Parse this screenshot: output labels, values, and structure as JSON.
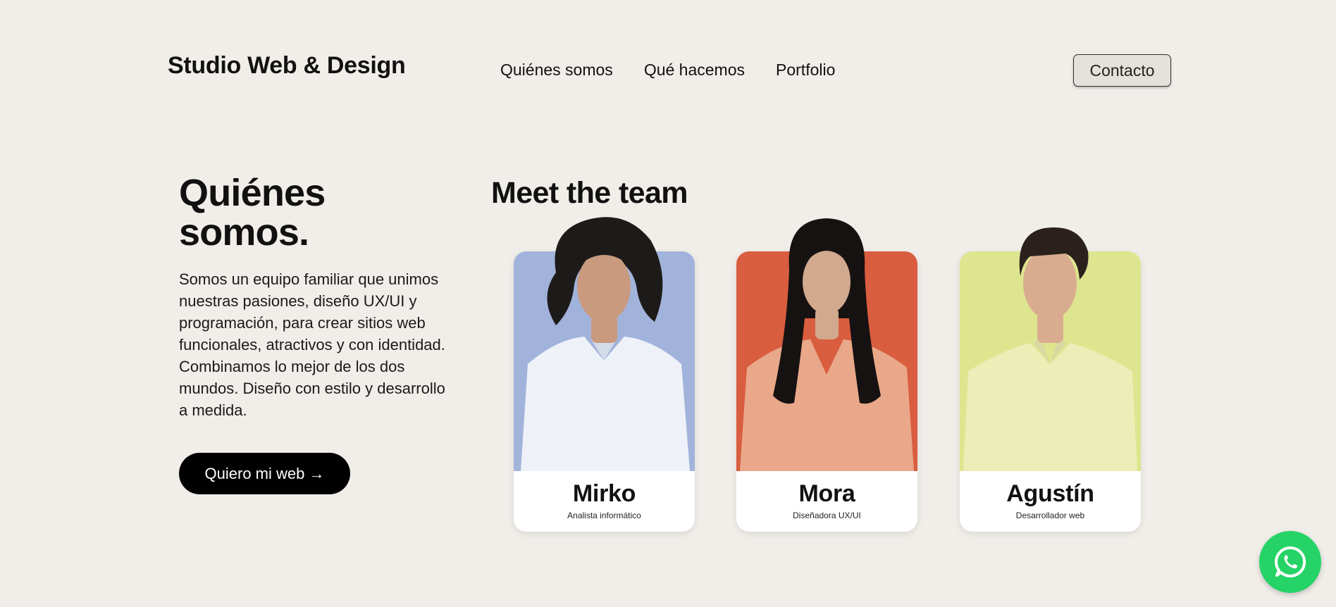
{
  "header": {
    "brand": "Studio Web & Design",
    "nav": [
      "Quiénes somos",
      "Qué hacemos",
      "Portfolio"
    ],
    "contact_label": "Contacto"
  },
  "about": {
    "heading": "Quiénes somos.",
    "paragraph_1": "Somos un equipo familiar que unimos nuestras pasiones, diseño UX/UI y programación, para crear sitios web funcionales, atractivos y con identidad.",
    "paragraph_2": "Combinamos lo mejor de los dos mundos. Diseño con estilo y desarrollo a medida.",
    "cta_label": "Quiero mi web →"
  },
  "team": {
    "title": "Meet the team",
    "members": [
      {
        "name": "Mirko",
        "role": "Analista informático",
        "bg_color": "#a2b3db",
        "shirt_color": "#eef2f8",
        "hair_color": "#1d1a1a",
        "skin_color": "#c99a7e"
      },
      {
        "name": "Mora",
        "role": "Diseñadora UX/UI",
        "bg_color": "#d95d3f",
        "shirt_color": "#e9a88a",
        "hair_color": "#171212",
        "skin_color": "#d1a98e"
      },
      {
        "name": "Agustín",
        "role": "Desarrollador web",
        "bg_color": "#dde58e",
        "shirt_color": "#ecedb7",
        "hair_color": "#2b211c",
        "skin_color": "#d9ac90"
      }
    ]
  },
  "whatsapp": {
    "icon": "whatsapp-icon",
    "color": "#25d366"
  }
}
